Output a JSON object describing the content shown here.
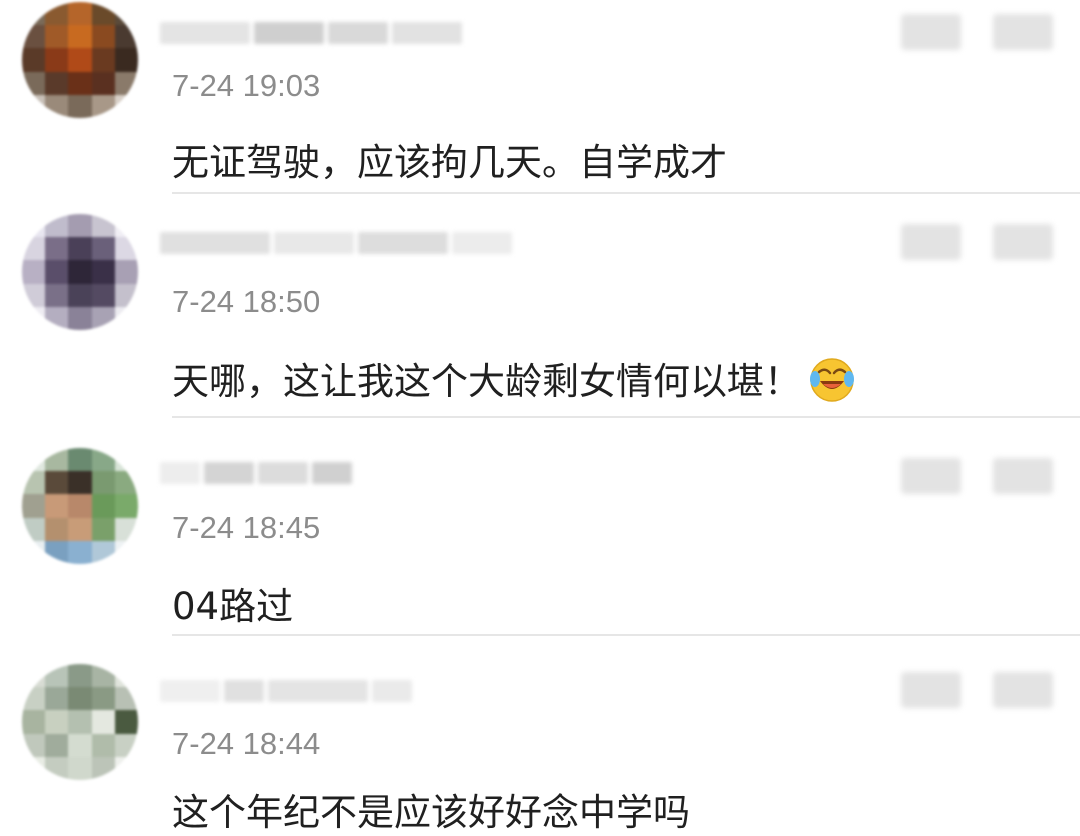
{
  "comments": [
    {
      "time": "7-24 19:03",
      "text": "无证驾驶，应该拘几天。自学成才",
      "avatar_colors": [
        "#7a6a58",
        "#8a5a30",
        "#b5652a",
        "#6a4a2a",
        "#5a4a3a",
        "#6a5040",
        "#a05a28",
        "#c86a20",
        "#8a4a20",
        "#4a3a30",
        "#5a3a28",
        "#8a3a18",
        "#b04a18",
        "#6a3a20",
        "#3a2a20",
        "#7a6a5a",
        "#5a3a2a",
        "#6a3018",
        "#5a3020",
        "#8a7a6a",
        "#c8c0b8",
        "#9a8a7a",
        "#7a6a5a",
        "#a89888",
        "#d8d0c8"
      ],
      "has_emoji": false
    },
    {
      "time": "7-24 18:50",
      "text": "天哪，这让我这个大龄剩女情何以堪！",
      "avatar_colors": [
        "#e8e6f0",
        "#c0bccc",
        "#a49cb0",
        "#c8c4d0",
        "#f0eef4",
        "#d8d4e0",
        "#7a6e88",
        "#4a4058",
        "#6a607a",
        "#dcd8e4",
        "#b8b0c4",
        "#5a4e6a",
        "#2e2638",
        "#3a3048",
        "#a8a0b4",
        "#d0ccd8",
        "#7a7088",
        "#4a4258",
        "#544a62",
        "#c4c0cc",
        "#eeecf2",
        "#b4aec0",
        "#8a8298",
        "#a8a2b4",
        "#ecebf0"
      ],
      "has_emoji": true
    },
    {
      "time": "7-24 18:45",
      "text": "04路过",
      "avatar_colors": [
        "#e0e8e0",
        "#a8b8a0",
        "#6a8a70",
        "#88a888",
        "#d8e4d8",
        "#b8c4b0",
        "#5a4a3a",
        "#3a3028",
        "#7a9a70",
        "#8aaa80",
        "#a0a090",
        "#c89a78",
        "#b8886a",
        "#6a9a5a",
        "#7aaa6a",
        "#c0ccc4",
        "#b4906e",
        "#c89c78",
        "#7aa06a",
        "#d8e0d8",
        "#e8eef0",
        "#7aa0c0",
        "#8ab0d0",
        "#b0c8d8",
        "#eef2f4"
      ],
      "has_emoji": false
    },
    {
      "time": "7-24 18:44",
      "text": "这个年纪不是应该好好念中学吗",
      "avatar_colors": [
        "#d8dcd4",
        "#b8c4b8",
        "#8a9a88",
        "#a8b4a4",
        "#e0e4dc",
        "#c8d0c4",
        "#9aa898",
        "#7a8a74",
        "#8a9a84",
        "#b8c0b4",
        "#a8b4a0",
        "#c8d0c0",
        "#b4c0b0",
        "#e4e8e0",
        "#4a5a40",
        "#c0c8bc",
        "#a0ac9c",
        "#d4dcd0",
        "#b0bcaa",
        "#c8d0c4",
        "#e8ece4",
        "#c4ccc0",
        "#d0d8cc",
        "#bcc4b8",
        "#eef0ec"
      ],
      "has_emoji": false
    }
  ]
}
